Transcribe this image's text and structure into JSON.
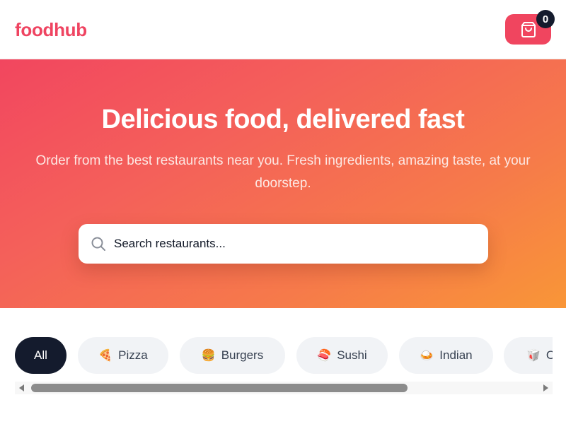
{
  "header": {
    "logo": "foodhub",
    "cart_count": "0",
    "cart_icon": "shopping-bag-icon"
  },
  "hero": {
    "title": "Delicious food, delivered fast",
    "subtitle": "Order from the best restaurants near you. Fresh ingredients, amazing taste, at your doorstep.",
    "search": {
      "placeholder": "Search restaurants...",
      "value": "",
      "icon": "search-icon"
    }
  },
  "categories": [
    {
      "label": "All",
      "emoji": "",
      "active": true
    },
    {
      "label": "Pizza",
      "emoji": "🍕",
      "active": false
    },
    {
      "label": "Burgers",
      "emoji": "🍔",
      "active": false
    },
    {
      "label": "Sushi",
      "emoji": "🍣",
      "active": false
    },
    {
      "label": "Indian",
      "emoji": "🍛",
      "active": false
    },
    {
      "label": "C",
      "emoji": "🥡",
      "active": false
    }
  ],
  "colors": {
    "brand": "#ef4461",
    "cart_button": "#f0455f",
    "dark": "#141b2d",
    "chip_bg": "#f1f3f6",
    "hero_gradient_start": "#f2465f",
    "hero_gradient_end": "#f99637"
  }
}
